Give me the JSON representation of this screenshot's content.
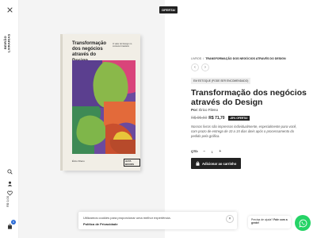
{
  "sidebar": {
    "logo_text": "BEIRÃO LIVRARIAS",
    "price_label": "R$ 0,00",
    "cart_count": "0"
  },
  "product_image": {
    "badge": "OFERTA!",
    "book_title": "Transformação dos negócios através do Design",
    "book_subtitle": "O valor do Design no contexto brasileiro",
    "book_author": "Érico Fileno",
    "book_publisher": "ALTA BOOKS"
  },
  "breadcrumb": {
    "parent": "LIVROS",
    "separator": "/",
    "current": "TRANSFORMAÇÃO DOS NEGÓCIOS ATRAVÉS DO DESIGN"
  },
  "navigation": {
    "prev": "‹",
    "next": "›"
  },
  "product": {
    "stock_status": "EM ESTOQUE (PODE SER ENCOMENDADO)",
    "title": "Transformação dos negócios através do Design",
    "author_label": "Por:",
    "author": "Érico Fileno",
    "old_price": "R$ 95,60",
    "price": "R$ 71,70",
    "discount": "-25% OFERTA!",
    "description": "Nossos livros são impressos individualmente, especialmente para você, com prazo de entrega de 10 a 15 dias úteis após o processamento do pedido pela gráfica.",
    "qty_label": "QTD:",
    "qty_minus": "−",
    "qty_value": "1",
    "qty_plus": "+",
    "add_to_cart": "Adicionar ao carrinho"
  },
  "cookie_notice": {
    "text": "Utilizamos cookies para proporcionar uma melhor experiência.",
    "link": "Política de Privacidade",
    "close": "×"
  },
  "help_chat": {
    "prompt": "Precisa de ajuda?",
    "action": "Fale com a gente!"
  },
  "colors": {
    "accent_dark": "#222222",
    "whatsapp_green": "#25d366",
    "cart_badge_blue": "#2a6bd6"
  }
}
